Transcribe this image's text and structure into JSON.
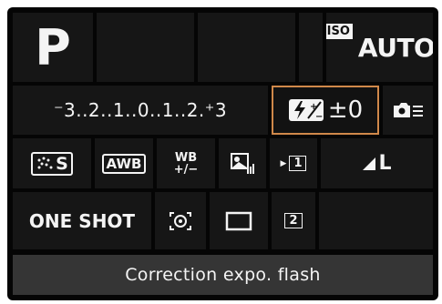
{
  "shooting_mode": "P",
  "iso": {
    "tag": "ISO",
    "value": "AUTO"
  },
  "exposure_scale": "⁻3..2..1..0..1..2.⁺3",
  "flash_comp": {
    "value": "±0"
  },
  "picture_style": {
    "label": "S"
  },
  "white_balance": {
    "label": "AWB"
  },
  "wb_shift": {
    "top": "WB",
    "bottom": "+/−"
  },
  "drive": {
    "single": "1",
    "timer": "2"
  },
  "af_mode": "ONE SHOT",
  "quality": "L",
  "status": {
    "text": "Correction expo. flash"
  },
  "colors": {
    "highlight": "#d0884a",
    "background": "#050505",
    "cell": "#161616",
    "status_bar": "#353535"
  }
}
